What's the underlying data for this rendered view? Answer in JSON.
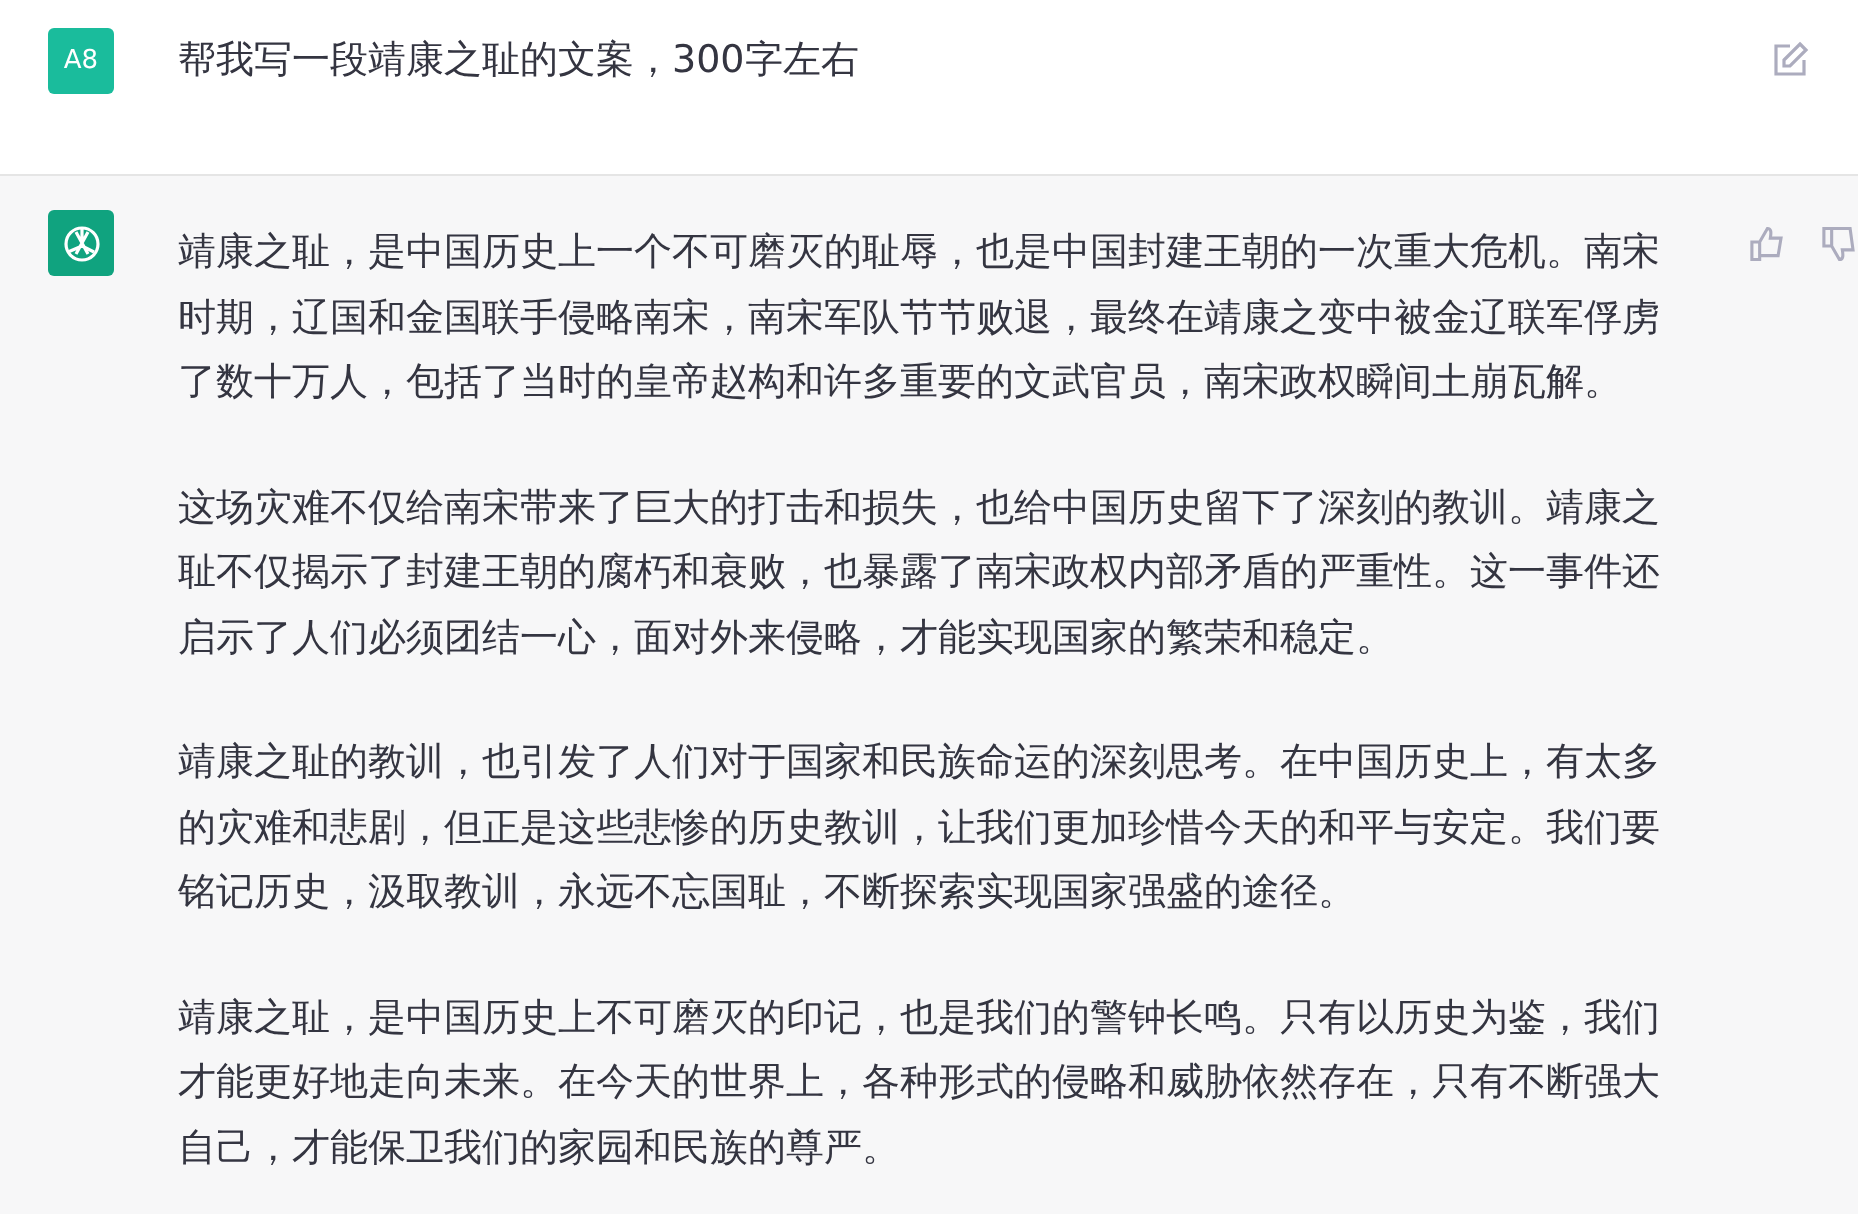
{
  "user_message": {
    "avatar": "A8",
    "text": "帮我写一段靖康之耻的文案，300字左右"
  },
  "assistant_message": {
    "paragraphs": [
      "靖康之耻，是中国历史上一个不可磨灭的耻辱，也是中国封建王朝的一次重大危机。南宋时期，辽国和金国联手侵略南宋，南宋军队节节败退，最终在靖康之变中被金辽联军俘虏了数十万人，包括了当时的皇帝赵构和许多重要的文武官员，南宋政权瞬间土崩瓦解。",
      "这场灾难不仅给南宋带来了巨大的打击和损失，也给中国历史留下了深刻的教训。靖康之耻不仅揭示了封建王朝的腐朽和衰败，也暴露了南宋政权内部矛盾的严重性。这一事件还启示了人们必须团结一心，面对外来侵略，才能实现国家的繁荣和稳定。",
      "靖康之耻的教训，也引发了人们对于国家和民族命运的深刻思考。在中国历史上，有太多的灾难和悲剧，但正是这些悲惨的历史教训，让我们更加珍惜今天的和平与安定。我们要铭记历史，汲取教训，永远不忘国耻，不断探索实现国家强盛的途径。",
      "靖康之耻，是中国历史上不可磨灭的印记，也是我们的警钟长鸣。只有以历史为鉴，我们才能更好地走向未来。在今天的世界上，各种形式的侵略和威胁依然存在，只有不断强大自己，才能保卫我们的家园和民族的尊严。"
    ]
  }
}
